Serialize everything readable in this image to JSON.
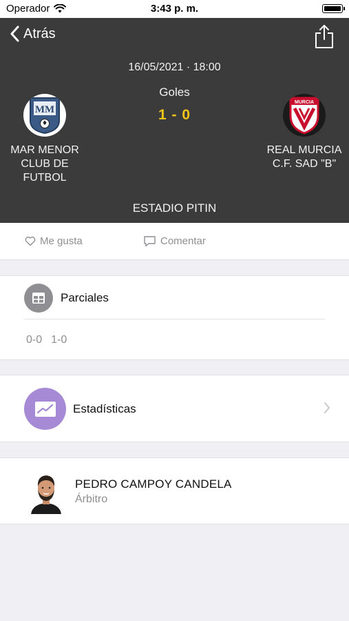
{
  "status_bar": {
    "carrier": "Operador",
    "time": "3:43 p. m."
  },
  "nav": {
    "back_label": "Atrás",
    "back_icon": "chevron-left-icon",
    "share_icon": "share-icon"
  },
  "match": {
    "datetime": "16/05/2021 · 18:00",
    "score_label": "Goles",
    "score": "1 - 0",
    "home_team": {
      "name": "MAR MENOR CLUB DE FUTBOL",
      "crest_letters": "MM"
    },
    "away_team": {
      "name": "REAL MURCIA C.F. SAD \"B\"",
      "crest_letters": "MURCIA"
    },
    "stadium": "ESTADIO PITIN"
  },
  "actions": {
    "like_label": "Me gusta",
    "comment_label": "Comentar"
  },
  "parciales": {
    "title": "Parciales",
    "values": [
      "0-0",
      "1-0"
    ]
  },
  "stats": {
    "title": "Estadísticas"
  },
  "referee": {
    "name": "PEDRO CAMPOY CANDELA",
    "role": "Árbitro"
  },
  "colors": {
    "header_bg": "#3b3b3b",
    "score": "#f2c519",
    "stats_icon": "#a78ad6",
    "muted": "#8e8e93"
  }
}
